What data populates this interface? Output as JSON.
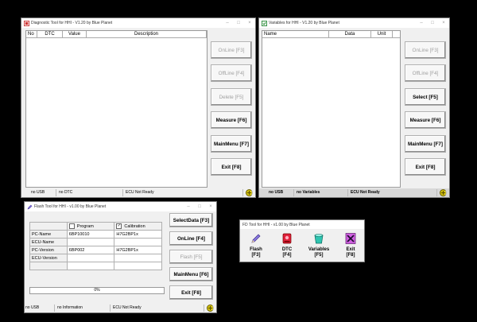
{
  "diag": {
    "title": "Diagnostic Tool for HHI - V1.20 by Blue Planet",
    "columns": [
      "No",
      "DTC",
      "Value",
      "Description"
    ],
    "buttons": {
      "online": "OnLine [F3]",
      "offline": "OffLine [F4]",
      "delete": "Delete [F5]",
      "measure": "Measure [F6]",
      "mainmenu": "MainMenu [F7]",
      "exit": "Exit [F8]"
    },
    "status": {
      "usb": "no USB",
      "dtc": "no DTC",
      "ecu": "ECU Not Ready"
    }
  },
  "vars": {
    "title": "Variables for HHI - V1.20 by Blue Planet",
    "columns": [
      "Name",
      "Data",
      "Unit"
    ],
    "buttons": {
      "online": "OnLine [F3]",
      "offline": "OffLine [F4]",
      "select": "Select [F5]",
      "measure": "Measure [F6]",
      "mainmenu": "MainMenu [F7]",
      "exit": "Exit [F8]"
    },
    "status": {
      "usb": "no USB",
      "variables": "no Variables",
      "ecu": "ECU Not Ready"
    }
  },
  "flash": {
    "title": "Flash Tool for HHI - v1.00 by Blue Planet",
    "checks": {
      "program": "Program",
      "calibration": "Calibration"
    },
    "rows": [
      {
        "label": "PC-Name",
        "program": "6BP10010",
        "calibration": "H7G2BP1x"
      },
      {
        "label": "ECU-Name",
        "program": "",
        "calibration": ""
      },
      {
        "label": "PC-Version",
        "program": "6BP002",
        "calibration": "H7G2BP1x"
      },
      {
        "label": "ECU-Version",
        "program": "",
        "calibration": ""
      }
    ],
    "progress_text": "0%",
    "progress_value": 0,
    "buttons": {
      "select": "SelectData [F3]",
      "online": "OnLine [F4]",
      "flash": "Flash [F5]",
      "mainmenu": "MainMenu [F6]",
      "exit": "Exit [F8]"
    },
    "status": {
      "usb": "no USB",
      "info": "no Information",
      "ecu": "ECU Not Ready"
    }
  },
  "fd": {
    "title": "FD Tool for HHI - v1.00 by Blue Planet",
    "items": [
      {
        "line1": "Flash",
        "line2": "[F3]",
        "icon": "pencil-icon"
      },
      {
        "line1": "DTC",
        "line2": "[F4]",
        "icon": "red-alert-icon"
      },
      {
        "line1": "Variables",
        "line2": "[F5]",
        "icon": "bucket-icon"
      },
      {
        "line1": "Exit",
        "line2": "[F8]",
        "icon": "close-x-icon"
      }
    ]
  }
}
